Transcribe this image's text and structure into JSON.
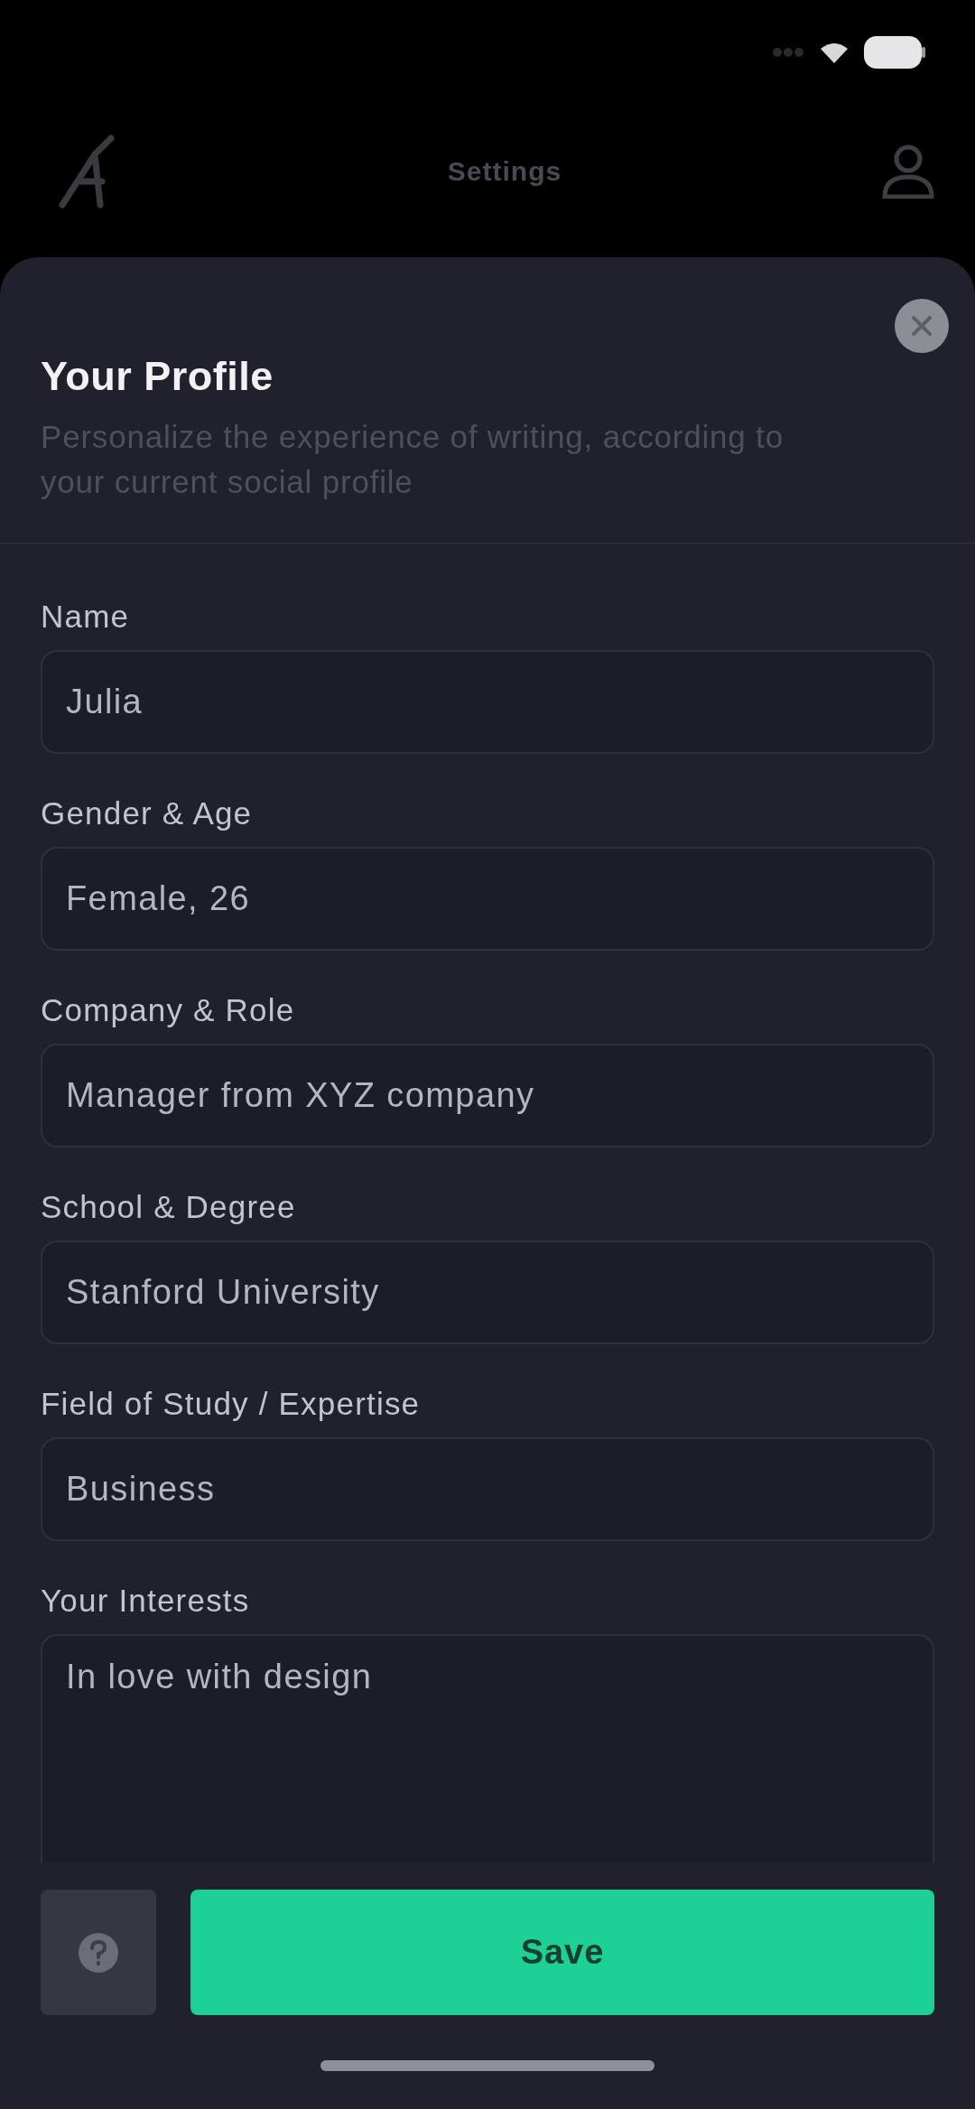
{
  "nav": {
    "title": "Settings"
  },
  "sheet": {
    "title": "Your Profile",
    "description": "Personalize the experience of writing, according to your current social profile"
  },
  "fields": [
    {
      "kind": "input",
      "label": "Name",
      "value": "Julia"
    },
    {
      "kind": "input",
      "label": "Gender & Age",
      "value": "Female, 26"
    },
    {
      "kind": "input",
      "label": "Company & Role",
      "value": "Manager from XYZ company"
    },
    {
      "kind": "input",
      "label": "School & Degree",
      "value": "Stanford University"
    },
    {
      "kind": "input",
      "label": "Field of Study / Expertise",
      "value": "Business"
    },
    {
      "kind": "textarea",
      "label": "Your Interests",
      "value": "In love with design"
    }
  ],
  "footer": {
    "save": "Save"
  }
}
